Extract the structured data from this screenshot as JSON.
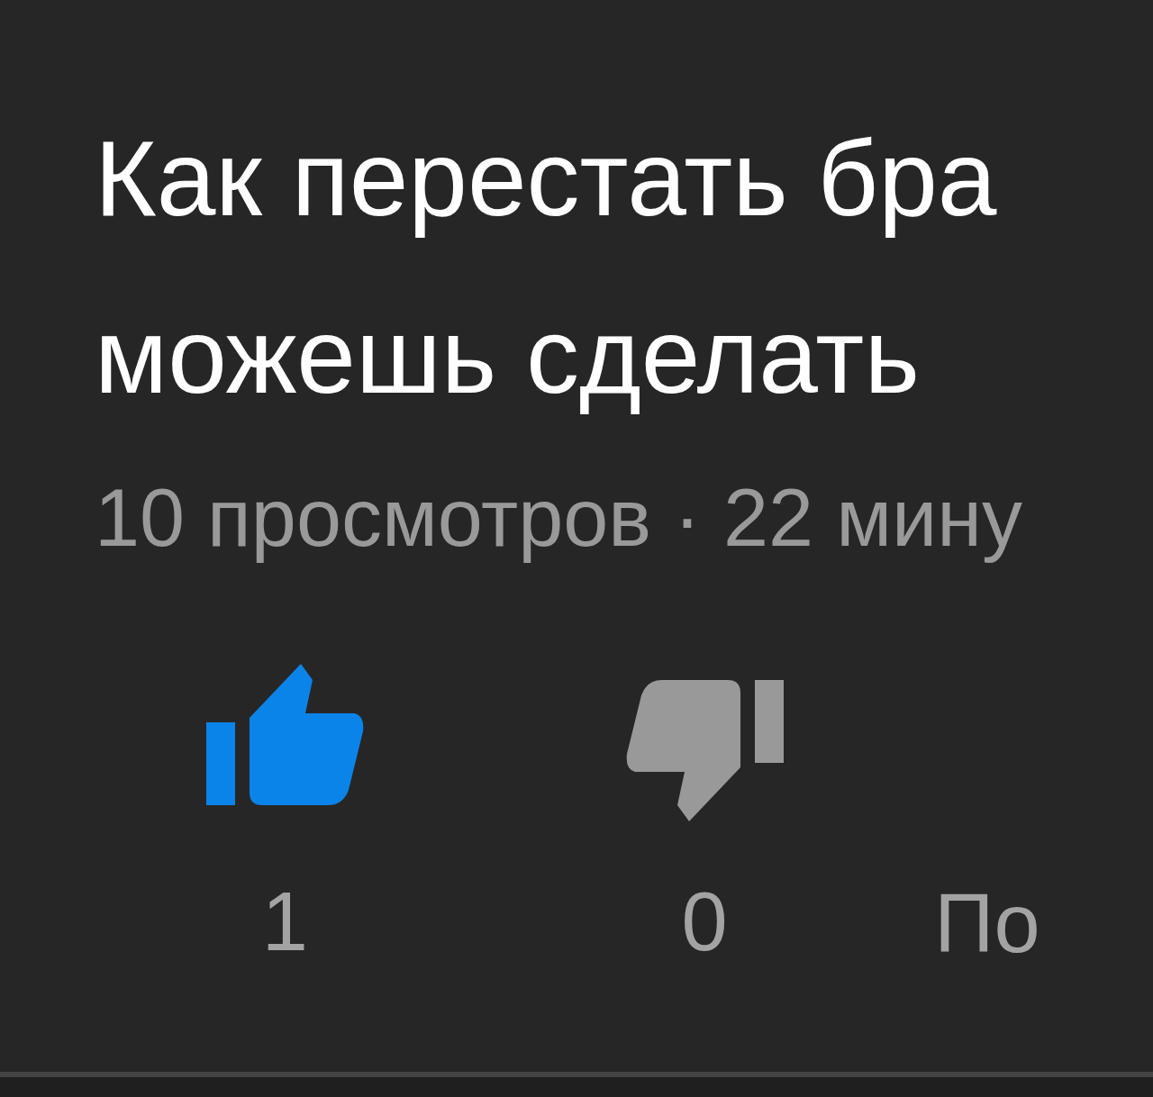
{
  "title_lines": [
    "Как перестать бра",
    "можешь сделать"
  ],
  "meta": "10 просмотров · 22 мину",
  "actions": [
    {
      "kind": "like",
      "count": "1",
      "selected": true
    },
    {
      "kind": "dislike",
      "count": "0",
      "selected": false
    },
    {
      "kind": "text",
      "label": "По"
    }
  ]
}
